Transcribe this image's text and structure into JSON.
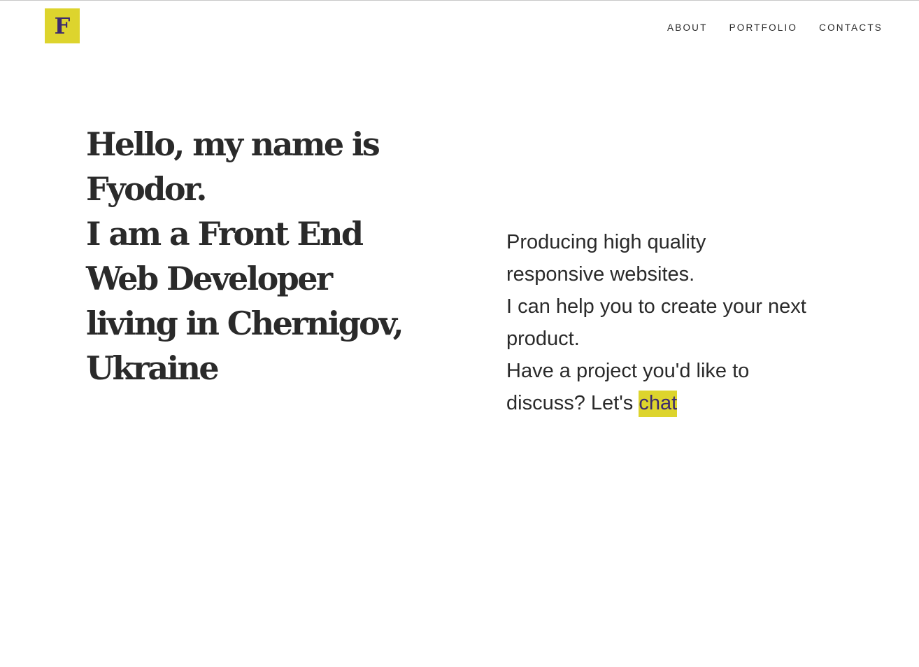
{
  "logo": {
    "letter": "F"
  },
  "nav": {
    "items": [
      {
        "label": "ABOUT"
      },
      {
        "label": "PORTFOLIO"
      },
      {
        "label": "CONTACTS"
      }
    ]
  },
  "hero": {
    "headline": [
      "Hello, my name is",
      "Fyodor.",
      "I am a Front End",
      "Web Developer",
      "living in Chernigov,",
      "Ukraine"
    ],
    "tagline": [
      "Producing high quality",
      "responsive websites.",
      "I can help you to create your next",
      "product.",
      "Have a project you'd like to"
    ],
    "cta_prefix": "discuss? Let's",
    "cta_link": "chat"
  },
  "colors": {
    "accent": "#ddd42d",
    "accent_text": "#3d2a6e",
    "text": "#2a2a2a",
    "background": "#ffffff"
  }
}
